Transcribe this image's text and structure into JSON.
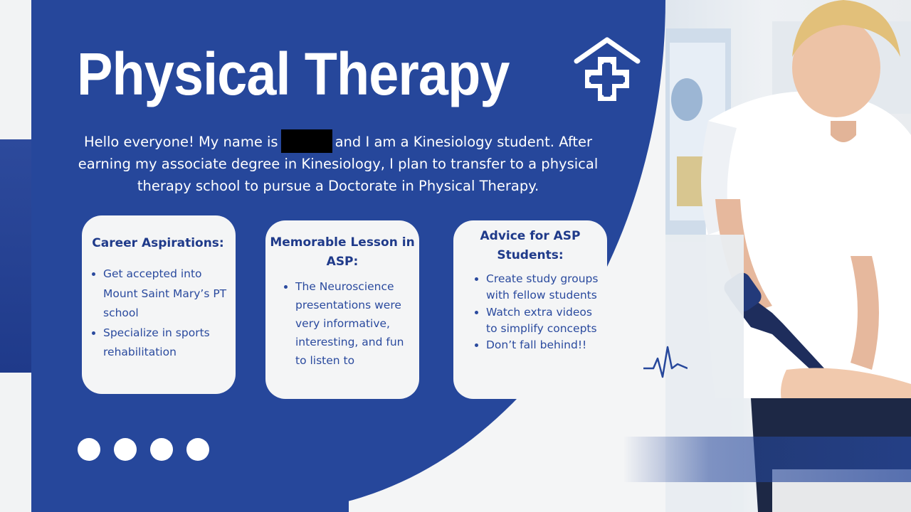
{
  "title": "Physical Therapy",
  "intro": {
    "part1": "Hello everyone! My name is",
    "part2": "and I am a Kinesiology student. After earning my associate degree in Kinesiology, I plan to transfer to a physical therapy school to pursue a Doctorate in Physical Therapy."
  },
  "cards": [
    {
      "heading": "Career Aspirations:",
      "items": [
        "Get accepted into Mount Saint Mary’s PT school",
        "Specialize in sports rehabilitation"
      ]
    },
    {
      "heading": "Memorable Lesson in ASP:",
      "items": [
        "The Neuroscience presentations were very informative, interesting, and fun to listen to"
      ]
    },
    {
      "heading": "Advice for ASP Students:",
      "items": [
        "Create study groups with fellow students",
        "Watch extra videos to simplify concepts",
        "Don’t fall behind!!"
      ]
    }
  ],
  "colors": {
    "primary_blue": "#26479b",
    "card_bg": "#f4f5f6",
    "text_blue": "#1f3a8a"
  },
  "icons": {
    "logo": "house-medical-cross-icon",
    "pulse": "heartbeat-line-icon"
  }
}
